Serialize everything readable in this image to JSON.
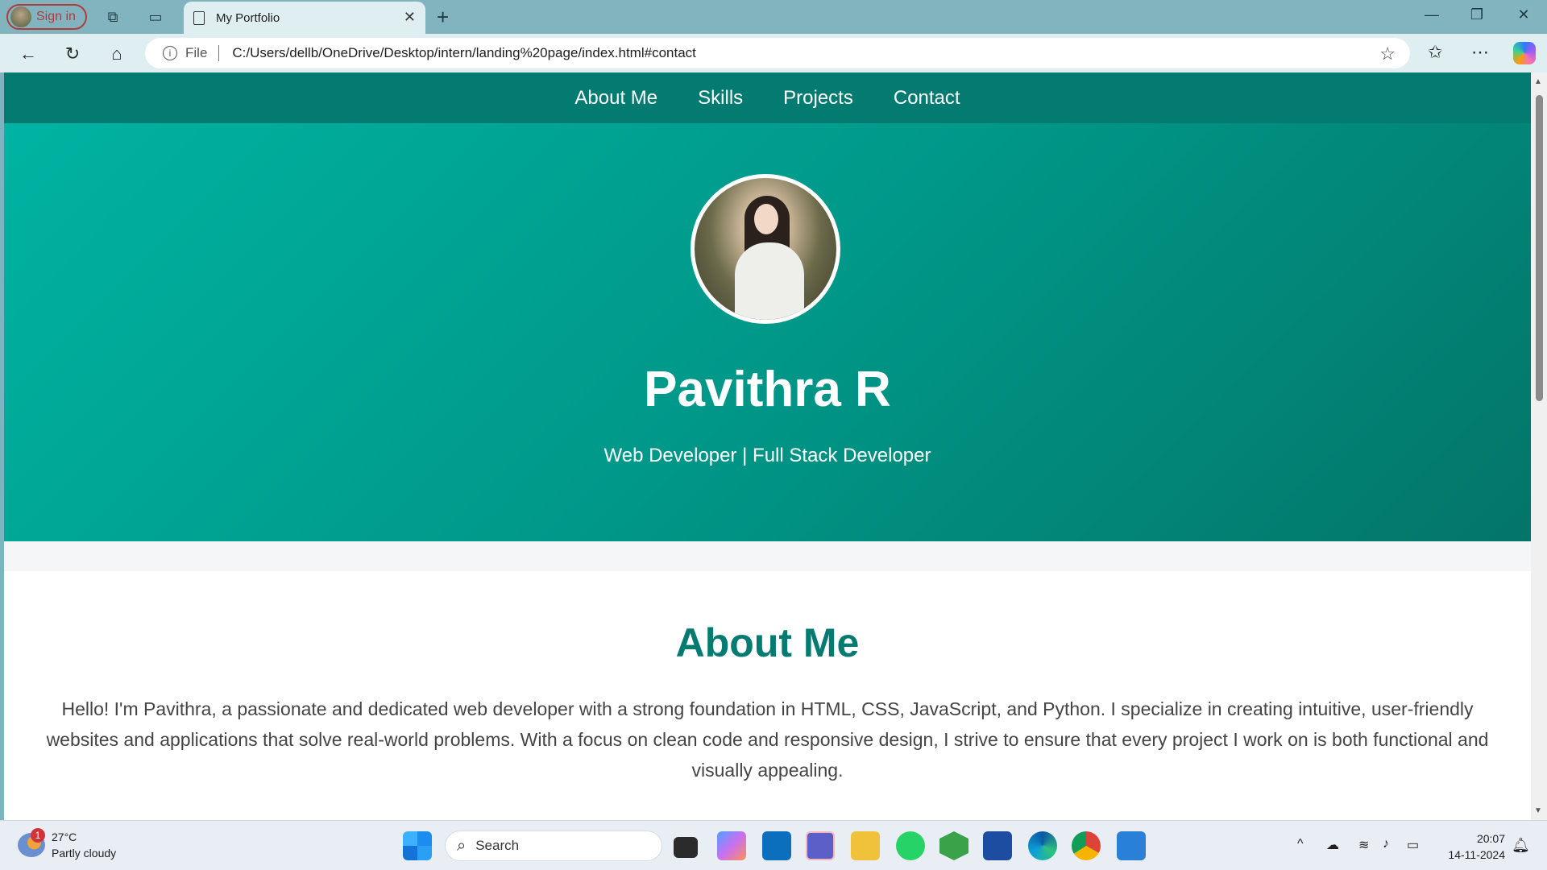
{
  "browser": {
    "profile_label": "Sign in",
    "tab_title": "My Portfolio",
    "address_scheme": "File",
    "address_url": "C:/Users/dellb/OneDrive/Desktop/intern/landing%20page/index.html#contact"
  },
  "site": {
    "nav": [
      "About Me",
      "Skills",
      "Projects",
      "Contact"
    ],
    "hero": {
      "name": "Pavithra R",
      "tagline": "Web Developer | Full Stack Developer"
    },
    "about": {
      "heading": "About Me",
      "paragraph": "Hello! I'm Pavithra, a passionate and dedicated web developer with a strong foundation in HTML, CSS, JavaScript, and Python. I specialize in creating intuitive, user-friendly websites and applications that solve real-world problems. With a focus on clean code and responsive design, I strive to ensure that every project I work on is both functional and visually appealing."
    }
  },
  "taskbar": {
    "weather_temp": "27°C",
    "weather_desc": "Partly cloudy",
    "weather_badge": "1",
    "search_label": "Search",
    "time": "20:07",
    "date": "14-11-2024"
  },
  "colors": {
    "brand": "#037b70",
    "hero_start": "#00b3a2",
    "hero_end": "#037568"
  }
}
